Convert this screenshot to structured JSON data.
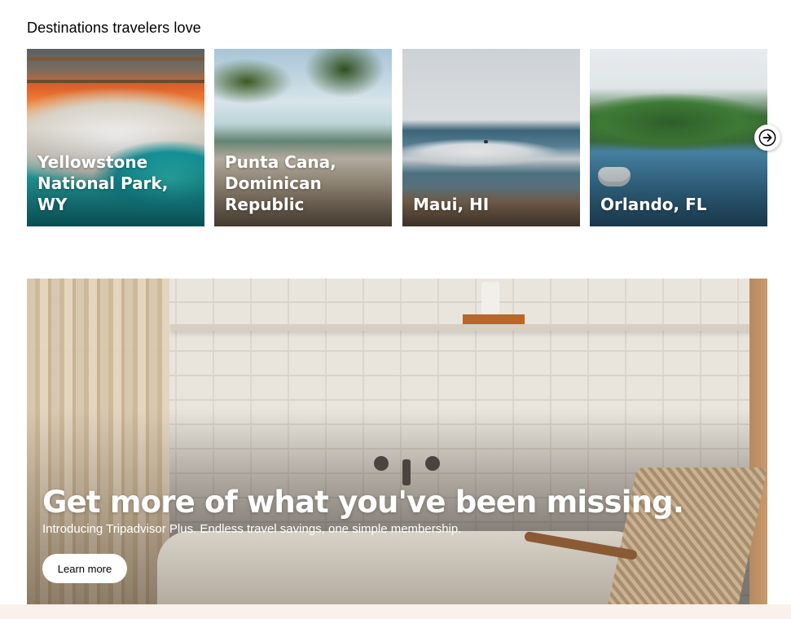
{
  "destinations": {
    "title": "Destinations travelers love",
    "cards": [
      {
        "label": "Yellowstone National Park, WY"
      },
      {
        "label": "Punta Cana, Dominican Republic"
      },
      {
        "label": "Maui, HI"
      },
      {
        "label": "Orlando, FL"
      }
    ],
    "next_icon": "arrow-right-icon"
  },
  "promo": {
    "headline": "Get more of what you've been missing.",
    "subline": "Introducing Tripadvisor Plus. Endless travel savings, one simple membership.",
    "cta_label": "Learn more"
  },
  "colors": {
    "background": "#ffffff",
    "bottom_band": "#fbf1ec",
    "card_text": "#ffffff"
  }
}
